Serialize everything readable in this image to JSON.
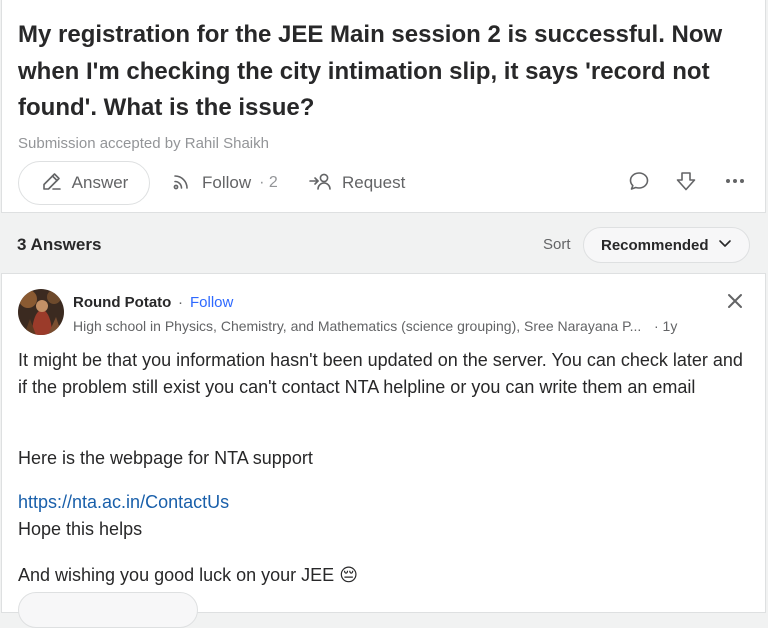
{
  "question": {
    "title": "My registration for the JEE Main session 2 is successful. Now when I'm checking the city intimation slip, it says 'record not found'. What is the issue?",
    "submission_text": "Submission accepted by Rahil Shaikh",
    "actions": {
      "answer_label": "Answer",
      "follow_label": "Follow",
      "follow_sep": "·",
      "follow_count": "2",
      "request_label": "Request"
    }
  },
  "answers_header": {
    "count_label": "3 Answers",
    "sort_label": "Sort",
    "sort_value": "Recommended"
  },
  "answer": {
    "author": "Round Potato",
    "dot": "·",
    "follow_label": "Follow",
    "credential": "High school in Physics, Chemistry, and Mathematics (science grouping), Sree Narayana P...",
    "time": "· 1y",
    "paragraphs": {
      "p1": "It might be that you information hasn't been updated on the server. You can check later and if the problem still exist you can't contact NTA helpline or you can write them an email",
      "p2": "Here is the webpage for NTA support",
      "link": "https://nta.ac.in/ContactUs",
      "p3": "Hope this helps",
      "p4": "And wishing you good luck on your JEE 😔"
    }
  },
  "colors": {
    "link": "#195faa",
    "follow": "#2e69ff",
    "border": "#dee0e1",
    "muted": "#939598"
  }
}
